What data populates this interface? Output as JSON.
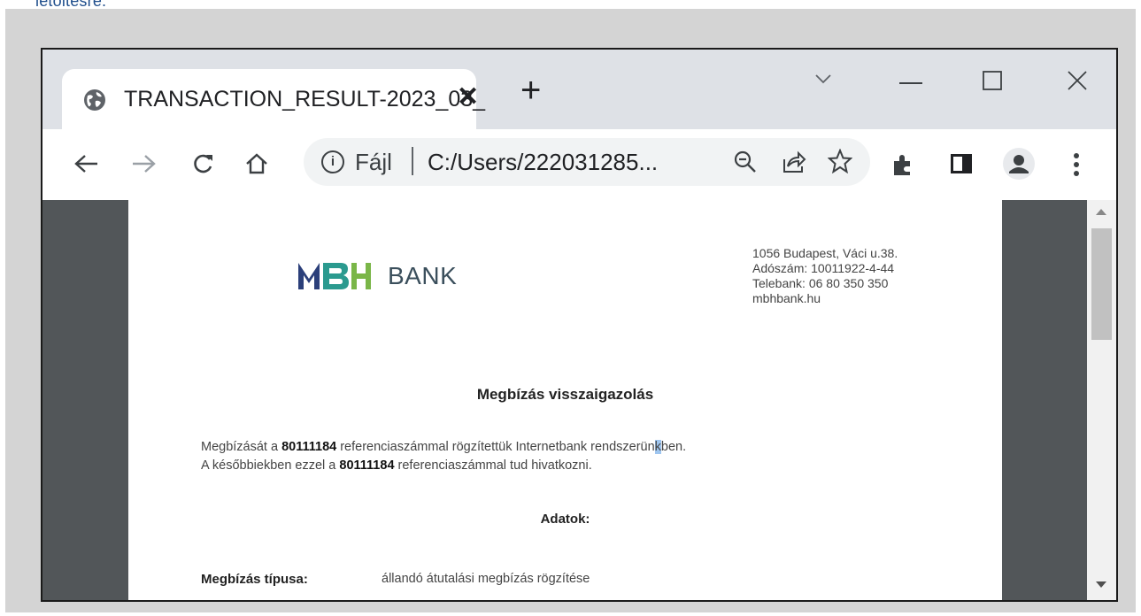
{
  "caption": "letöltésre.",
  "tab": {
    "title": "TRANSACTION_RESULT-2023_03_",
    "close_glyph": "✕",
    "icon": "globe-icon"
  },
  "new_tab_glyph": "+",
  "window_controls": {
    "dropdown": "chevron-down-icon",
    "minimize": "minimize-icon",
    "maximize": "maximize-icon",
    "close": "close-icon"
  },
  "omnibox": {
    "scheme_label": "Fájl",
    "url": "C:/Users/222031285..."
  },
  "toolbar_icons": [
    "back-icon",
    "forward-icon",
    "reload-icon",
    "home-icon",
    "info-icon",
    "zoom-icon",
    "share-icon",
    "star-icon",
    "extensions-icon",
    "side-panel-icon",
    "profile-icon",
    "menu-icon"
  ],
  "colors": {
    "brand_dark": "#2b3f7a",
    "brand_teal": "#2b9a8f",
    "brand_green": "#7ab648",
    "highlight": "#9ec5ef"
  },
  "document": {
    "logo_text": "BANK",
    "contact": [
      "1056 Budapest, Váci u.38.",
      "Adószám: 10011922-4-44",
      "Telebank: 06 80 350 350",
      "mbhbank.hu"
    ],
    "title": "Megbízás visszaigazolás",
    "line1_a": "Megbízását a ",
    "ref_number": "80111184",
    "line1_b": " referenciaszámmal rögzítettük Internetbank rendszerün",
    "line1_hl": "k",
    "line1_c": "ben.",
    "line2_a": "A későbbiekben ezzel a ",
    "line2_b": " referenciaszámmal tud hivatkozni.",
    "section_title": "Adatok:",
    "field_label": "Megbízás típusa:",
    "field_value": "állandó átutalási megbízás rögzítése"
  }
}
